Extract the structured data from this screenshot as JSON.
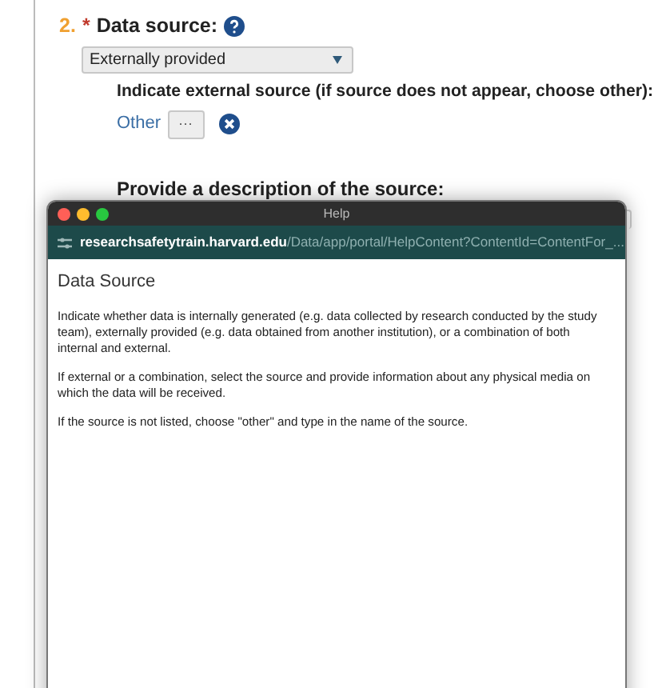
{
  "question": {
    "number": "2.",
    "required": "*",
    "label": "Data source:"
  },
  "select": {
    "value": "Externally provided"
  },
  "external_source": {
    "label": "Indicate external source (if source does not appear, choose other):",
    "link": "Other",
    "browse_button": "···"
  },
  "description": {
    "label": "Provide a description of the source:"
  },
  "help_window": {
    "title": "Help",
    "url_host": "researchsafetytrain.harvard.edu",
    "url_path": "/Data/app/portal/HelpContent?ContentId=ContentFor_...",
    "heading": "Data Source",
    "paragraphs": [
      "Indicate whether data is internally generated (e.g. data collected by research conducted by the study team), externally provided (e.g. data obtained from another institution), or a combination of both internal and external.",
      "If external or a combination, select the source and provide information about any physical media on which the data will be received.",
      "If the source is not listed, choose \"other\" and type in the name of the source."
    ]
  }
}
